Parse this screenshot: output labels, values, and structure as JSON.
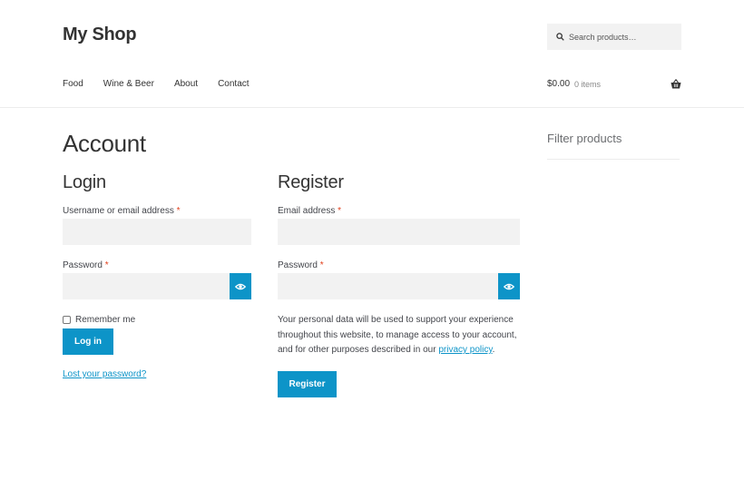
{
  "site": {
    "title": "My Shop"
  },
  "search": {
    "placeholder": "Search products…"
  },
  "nav": {
    "items": [
      "Food",
      "Wine & Beer",
      "About",
      "Contact"
    ]
  },
  "cart": {
    "total": "$0.00",
    "count": "0 items"
  },
  "page": {
    "title": "Account"
  },
  "login": {
    "title": "Login",
    "username_label": "Username or email address",
    "password_label": "Password",
    "required_mark": "*",
    "remember_label": "Remember me",
    "remember_checked": false,
    "button_label": "Log in",
    "lost_password_link": "Lost your password?"
  },
  "register": {
    "title": "Register",
    "email_label": "Email address",
    "password_label": "Password",
    "required_mark": "*",
    "privacy_text_before": "Your personal data will be used to support your experience throughout this website, to manage access to your account, and for other purposes described in our ",
    "privacy_link": "privacy policy",
    "privacy_text_after": ".",
    "button_label": "Register"
  },
  "sidebar": {
    "title": "Filter products"
  },
  "colors": {
    "accent": "#0d94c8",
    "required": "#e2401c",
    "input_bg": "#f2f2f2"
  }
}
